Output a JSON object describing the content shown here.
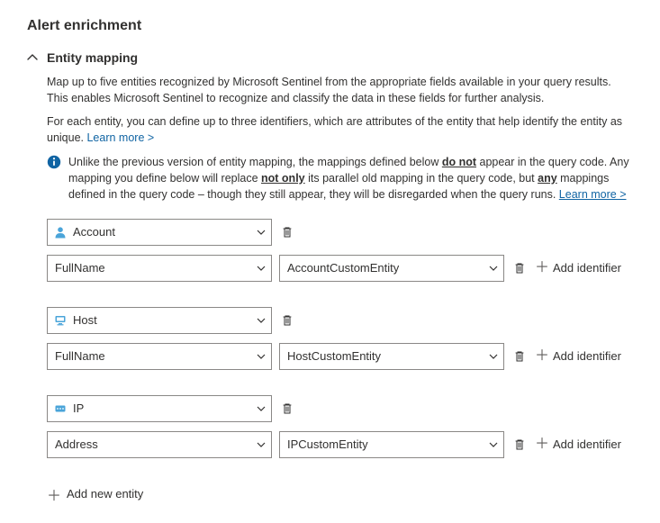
{
  "page_title": "Alert enrichment",
  "section": {
    "title": "Entity mapping",
    "desc1": "Map up to five entities recognized by Microsoft Sentinel from the appropriate fields available in your query results. This enables Microsoft Sentinel to recognize and classify the data in these fields for further analysis.",
    "desc2_a": "For each entity, you can define up to three identifiers, which are attributes of the entity that help identify the entity as unique. ",
    "learn_more": "Learn more >",
    "info_a": "Unlike the previous version of entity mapping, the mappings defined below ",
    "info_b": "do not",
    "info_c": " appear in the query code. Any mapping you define below will replace ",
    "info_d": "not only",
    "info_e": " its parallel old mapping in the query code, but ",
    "info_f": "any",
    "info_g": " mappings defined in the query code – though they still appear, they will be disregarded when the query runs. ",
    "info_learn": "Learn more >"
  },
  "entities": [
    {
      "type": "Account",
      "icon": "account",
      "attr": "FullName",
      "field": "AccountCustomEntity"
    },
    {
      "type": "Host",
      "icon": "host",
      "attr": "FullName",
      "field": "HostCustomEntity"
    },
    {
      "type": "IP",
      "icon": "ip",
      "attr": "Address",
      "field": "IPCustomEntity"
    }
  ],
  "buttons": {
    "add_identifier": "Add identifier",
    "add_entity": "Add new entity"
  }
}
